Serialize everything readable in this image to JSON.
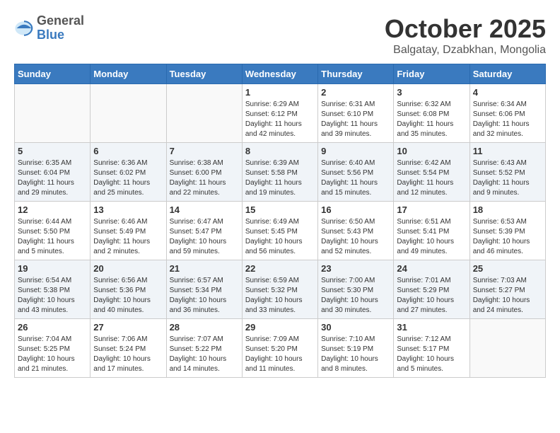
{
  "header": {
    "logo": {
      "general": "General",
      "blue": "Blue"
    },
    "title": "October 2025",
    "location": "Balgatay, Dzabkhan, Mongolia"
  },
  "weekdays": [
    "Sunday",
    "Monday",
    "Tuesday",
    "Wednesday",
    "Thursday",
    "Friday",
    "Saturday"
  ],
  "weeks": [
    [
      {
        "day": "",
        "info": ""
      },
      {
        "day": "",
        "info": ""
      },
      {
        "day": "",
        "info": ""
      },
      {
        "day": "1",
        "info": "Sunrise: 6:29 AM\nSunset: 6:12 PM\nDaylight: 11 hours\nand 42 minutes."
      },
      {
        "day": "2",
        "info": "Sunrise: 6:31 AM\nSunset: 6:10 PM\nDaylight: 11 hours\nand 39 minutes."
      },
      {
        "day": "3",
        "info": "Sunrise: 6:32 AM\nSunset: 6:08 PM\nDaylight: 11 hours\nand 35 minutes."
      },
      {
        "day": "4",
        "info": "Sunrise: 6:34 AM\nSunset: 6:06 PM\nDaylight: 11 hours\nand 32 minutes."
      }
    ],
    [
      {
        "day": "5",
        "info": "Sunrise: 6:35 AM\nSunset: 6:04 PM\nDaylight: 11 hours\nand 29 minutes."
      },
      {
        "day": "6",
        "info": "Sunrise: 6:36 AM\nSunset: 6:02 PM\nDaylight: 11 hours\nand 25 minutes."
      },
      {
        "day": "7",
        "info": "Sunrise: 6:38 AM\nSunset: 6:00 PM\nDaylight: 11 hours\nand 22 minutes."
      },
      {
        "day": "8",
        "info": "Sunrise: 6:39 AM\nSunset: 5:58 PM\nDaylight: 11 hours\nand 19 minutes."
      },
      {
        "day": "9",
        "info": "Sunrise: 6:40 AM\nSunset: 5:56 PM\nDaylight: 11 hours\nand 15 minutes."
      },
      {
        "day": "10",
        "info": "Sunrise: 6:42 AM\nSunset: 5:54 PM\nDaylight: 11 hours\nand 12 minutes."
      },
      {
        "day": "11",
        "info": "Sunrise: 6:43 AM\nSunset: 5:52 PM\nDaylight: 11 hours\nand 9 minutes."
      }
    ],
    [
      {
        "day": "12",
        "info": "Sunrise: 6:44 AM\nSunset: 5:50 PM\nDaylight: 11 hours\nand 5 minutes."
      },
      {
        "day": "13",
        "info": "Sunrise: 6:46 AM\nSunset: 5:49 PM\nDaylight: 11 hours\nand 2 minutes."
      },
      {
        "day": "14",
        "info": "Sunrise: 6:47 AM\nSunset: 5:47 PM\nDaylight: 10 hours\nand 59 minutes."
      },
      {
        "day": "15",
        "info": "Sunrise: 6:49 AM\nSunset: 5:45 PM\nDaylight: 10 hours\nand 56 minutes."
      },
      {
        "day": "16",
        "info": "Sunrise: 6:50 AM\nSunset: 5:43 PM\nDaylight: 10 hours\nand 52 minutes."
      },
      {
        "day": "17",
        "info": "Sunrise: 6:51 AM\nSunset: 5:41 PM\nDaylight: 10 hours\nand 49 minutes."
      },
      {
        "day": "18",
        "info": "Sunrise: 6:53 AM\nSunset: 5:39 PM\nDaylight: 10 hours\nand 46 minutes."
      }
    ],
    [
      {
        "day": "19",
        "info": "Sunrise: 6:54 AM\nSunset: 5:38 PM\nDaylight: 10 hours\nand 43 minutes."
      },
      {
        "day": "20",
        "info": "Sunrise: 6:56 AM\nSunset: 5:36 PM\nDaylight: 10 hours\nand 40 minutes."
      },
      {
        "day": "21",
        "info": "Sunrise: 6:57 AM\nSunset: 5:34 PM\nDaylight: 10 hours\nand 36 minutes."
      },
      {
        "day": "22",
        "info": "Sunrise: 6:59 AM\nSunset: 5:32 PM\nDaylight: 10 hours\nand 33 minutes."
      },
      {
        "day": "23",
        "info": "Sunrise: 7:00 AM\nSunset: 5:30 PM\nDaylight: 10 hours\nand 30 minutes."
      },
      {
        "day": "24",
        "info": "Sunrise: 7:01 AM\nSunset: 5:29 PM\nDaylight: 10 hours\nand 27 minutes."
      },
      {
        "day": "25",
        "info": "Sunrise: 7:03 AM\nSunset: 5:27 PM\nDaylight: 10 hours\nand 24 minutes."
      }
    ],
    [
      {
        "day": "26",
        "info": "Sunrise: 7:04 AM\nSunset: 5:25 PM\nDaylight: 10 hours\nand 21 minutes."
      },
      {
        "day": "27",
        "info": "Sunrise: 7:06 AM\nSunset: 5:24 PM\nDaylight: 10 hours\nand 17 minutes."
      },
      {
        "day": "28",
        "info": "Sunrise: 7:07 AM\nSunset: 5:22 PM\nDaylight: 10 hours\nand 14 minutes."
      },
      {
        "day": "29",
        "info": "Sunrise: 7:09 AM\nSunset: 5:20 PM\nDaylight: 10 hours\nand 11 minutes."
      },
      {
        "day": "30",
        "info": "Sunrise: 7:10 AM\nSunset: 5:19 PM\nDaylight: 10 hours\nand 8 minutes."
      },
      {
        "day": "31",
        "info": "Sunrise: 7:12 AM\nSunset: 5:17 PM\nDaylight: 10 hours\nand 5 minutes."
      },
      {
        "day": "",
        "info": ""
      }
    ]
  ]
}
